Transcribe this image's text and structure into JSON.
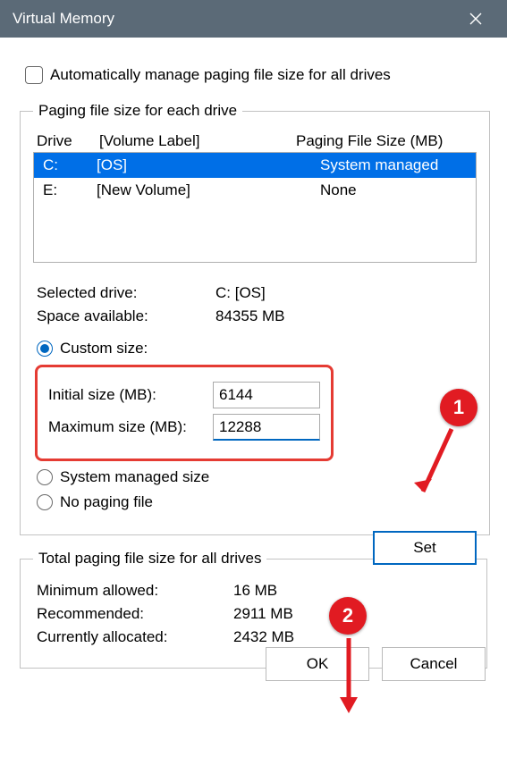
{
  "title": "Virtual Memory",
  "auto_manage_label": "Automatically manage paging file size for all drives",
  "group1_legend": "Paging file size for each drive",
  "headers": {
    "drive": "Drive",
    "volume": "[Volume Label]",
    "pfs": "Paging File Size (MB)"
  },
  "drives": [
    {
      "drive": "C:",
      "volume": "[OS]",
      "pfs": "System managed"
    },
    {
      "drive": "E:",
      "volume": "[New Volume]",
      "pfs": "None"
    }
  ],
  "selected_drive_label": "Selected drive:",
  "selected_drive_value": "C:  [OS]",
  "space_avail_label": "Space available:",
  "space_avail_value": "84355 MB",
  "radio_custom": "Custom size:",
  "initial_label": "Initial size (MB):",
  "initial_value": "6144",
  "max_label": "Maximum size (MB):",
  "max_value": "12288",
  "radio_sysmanaged": "System managed size",
  "radio_nopaging": "No paging file",
  "set_label": "Set",
  "group2_legend": "Total paging file size for all drives",
  "min_allowed_label": "Minimum allowed:",
  "min_allowed_value": "16 MB",
  "recommended_label": "Recommended:",
  "recommended_value": "2911 MB",
  "current_label": "Currently allocated:",
  "current_value": "2432 MB",
  "ok_label": "OK",
  "cancel_label": "Cancel",
  "badge1": "1",
  "badge2": "2"
}
